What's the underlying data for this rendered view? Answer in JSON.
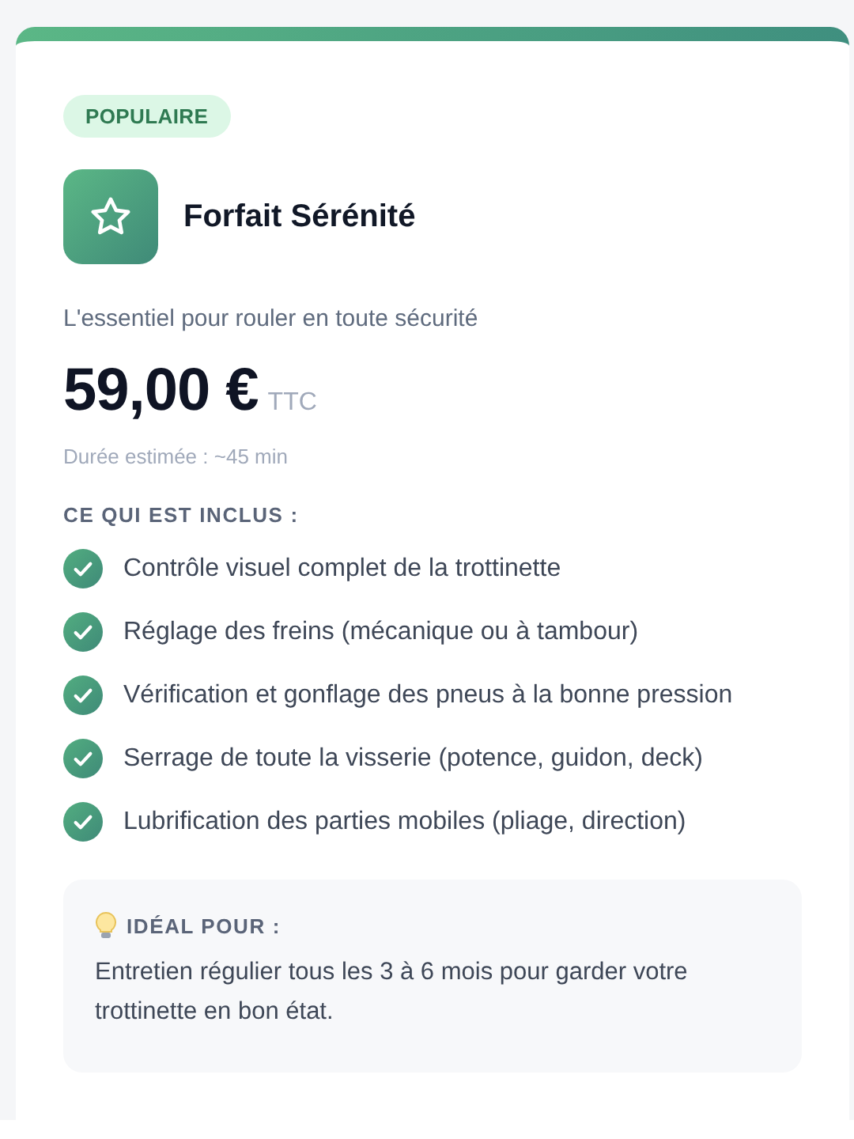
{
  "badge": "POPULAIRE",
  "title": "Forfait Sérénité",
  "description": "L'essentiel pour rouler en toute sécurité",
  "price": "59,00 €",
  "price_suffix": "TTC",
  "duration": "Durée estimée : ~45 min",
  "included_heading": "CE QUI EST INCLUS :",
  "included": [
    "Contrôle visuel complet de la trottinette",
    "Réglage des freins (mécanique ou à tambour)",
    "Vérification et gonflage des pneus à la bonne pression",
    "Serrage de toute la visserie (potence, guidon, deck)",
    "Lubrification des parties mobiles (pliage, direction)"
  ],
  "tip": {
    "heading": "IDÉAL POUR :",
    "text": "Entretien régulier tous les 3 à 6 mois pour garder votre trottinette en bon état."
  }
}
